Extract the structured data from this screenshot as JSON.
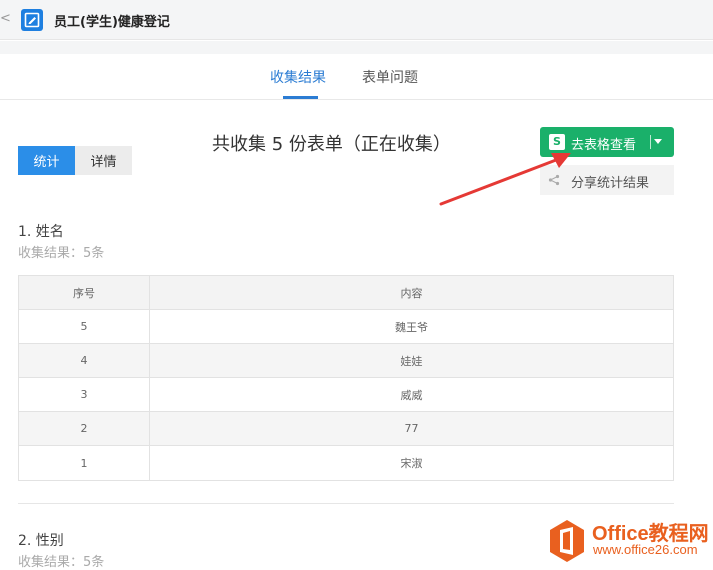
{
  "window": {
    "back_glyph": "<",
    "title": "员工(学生)健康登记"
  },
  "tabs": [
    {
      "label": "收集结果",
      "active": true
    },
    {
      "label": "表单问题",
      "active": false
    }
  ],
  "view_toggle": {
    "stats": "统计",
    "detail": "详情",
    "selected": "统计"
  },
  "summary": {
    "headline": "共收集 5 份表单（正在收集）"
  },
  "actions": {
    "sheet_button": {
      "icon_letter": "S",
      "label": "去表格查看"
    },
    "share_button": {
      "label": "分享统计结果"
    }
  },
  "questions": [
    {
      "title": "1.  姓名",
      "result": "收集结果：5条",
      "table": {
        "headers": [
          "序号",
          "内容"
        ],
        "rows": [
          {
            "index": "5",
            "content": "魏王爷"
          },
          {
            "index": "4",
            "content": "娃娃"
          },
          {
            "index": "3",
            "content": "威威"
          },
          {
            "index": "2",
            "content": "77"
          },
          {
            "index": "1",
            "content": "宋淑"
          }
        ]
      }
    },
    {
      "title": "2.  性别",
      "result": "收集结果：5条"
    }
  ],
  "watermark": {
    "name": "Office教程网",
    "url": "www.office26.com"
  },
  "colors": {
    "accent_blue": "#2b7cd3",
    "toggle_blue": "#2b8ee8",
    "sheet_green": "#1ab06a",
    "arrow_red": "#e53935",
    "watermark_orange": "#e9601f"
  },
  "icons": [
    "back-icon",
    "form-app-icon",
    "sheet-icon",
    "dropdown-caret-icon",
    "share-icon",
    "annotation-arrow",
    "office-logo-icon"
  ]
}
